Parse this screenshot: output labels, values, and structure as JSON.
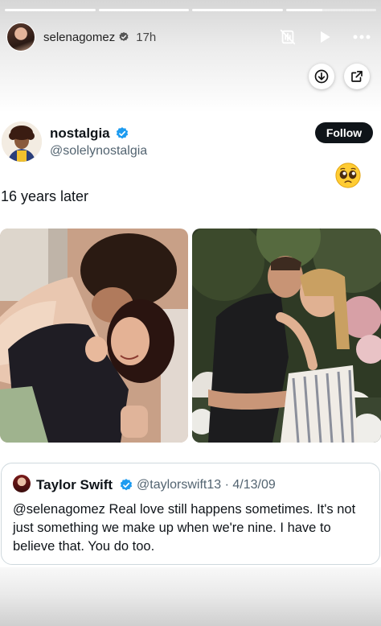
{
  "story": {
    "segments": 4,
    "username": "selenagomez",
    "time": "17h",
    "icons": {
      "verified": "verified-badge-icon",
      "mute": "audio-off-icon",
      "play": "play-icon",
      "more": "more-dots-icon",
      "download": "download-icon",
      "share": "share-external-icon"
    }
  },
  "post": {
    "name": "nostalgia",
    "handle": "@solelynostalgia",
    "follow_label": "Follow",
    "emoji": "pleading-face-emoji",
    "text": "16 years later"
  },
  "quote": {
    "name": "Taylor Swift",
    "handle_date": "@taylorswift13 · 4/13/09",
    "text": "@selenagomez Real love still happens sometimes. It's not just something we make up when we're nine. I have to believe that. You do too."
  },
  "colors": {
    "verified_blue": "#1d9bf0",
    "follow_bg": "#0f1419",
    "text_primary": "#0f1419",
    "text_secondary": "#536471"
  }
}
